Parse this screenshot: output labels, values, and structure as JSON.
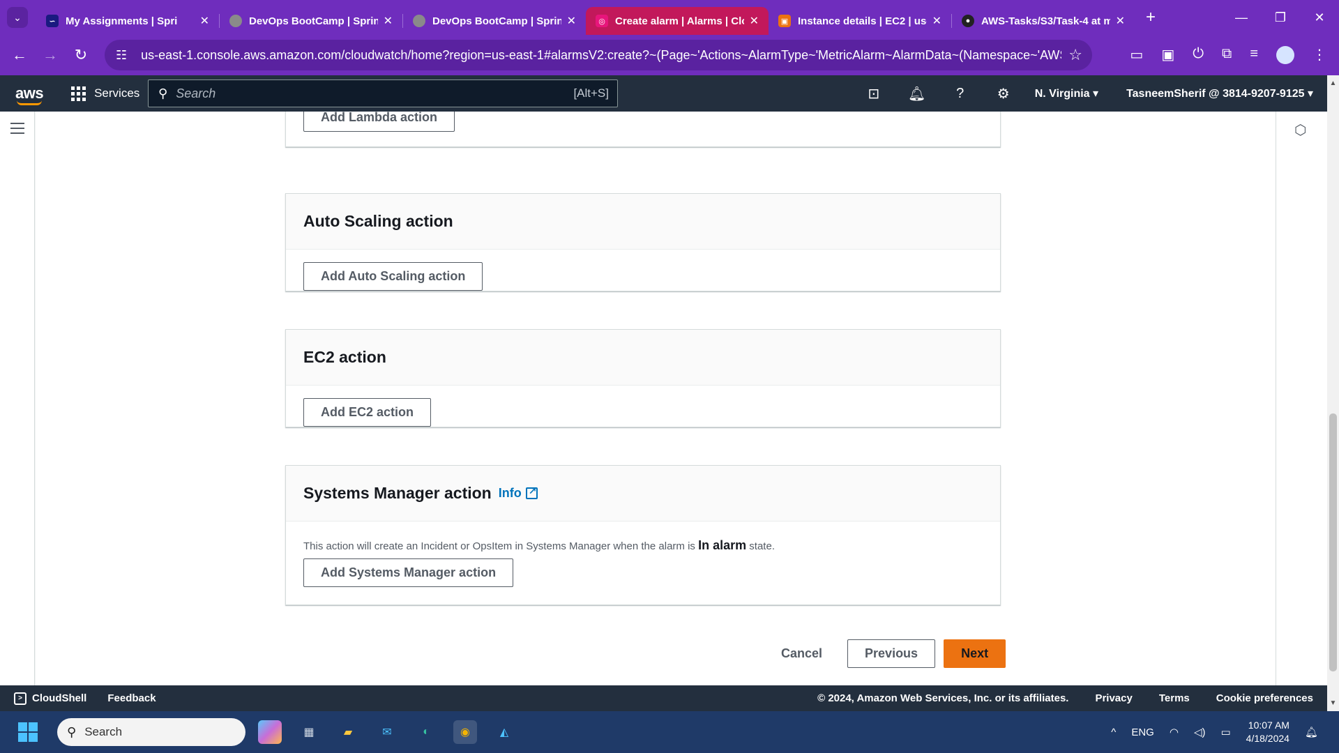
{
  "browser": {
    "tabs": [
      {
        "title": "My Assignments | Spri",
        "favicon": "sprints-icon",
        "color": "#7b3fe4",
        "active": false
      },
      {
        "title": "DevOps BootCamp | Sprin",
        "favicon": "globe-icon",
        "color": "#8a8a8a",
        "active": false
      },
      {
        "title": "DevOps BootCamp | Sprin",
        "favicon": "globe-icon",
        "color": "#8a8a8a",
        "active": false
      },
      {
        "title": "Create alarm | Alarms | Clo",
        "favicon": "cloudwatch-icon",
        "color": "#e7157b",
        "active": true
      },
      {
        "title": "Instance details | EC2 | us-",
        "favicon": "ec2-icon",
        "color": "#ec7211",
        "active": false
      },
      {
        "title": "AWS-Tasks/S3/Task-4 at m",
        "favicon": "github-icon",
        "color": "#222222",
        "active": false
      }
    ],
    "url": "us-east-1.console.aws.amazon.com/cloudwatch/home?region=us-east-1#alarmsV2:create?~(Page~'Actions~AlarmType~'MetricAlarm~AlarmData~(Namespace~'AWS*2f..."
  },
  "awsnav": {
    "logo": "aws",
    "services_label": "Services",
    "search_placeholder": "Search",
    "search_shortcut": "[Alt+S]",
    "region": "N. Virginia",
    "account": "TasneemSherif @ 3814-9207-9125"
  },
  "sections": {
    "lambda": {
      "button": "Add Lambda action"
    },
    "autoscaling": {
      "title": "Auto Scaling action",
      "button": "Add Auto Scaling action"
    },
    "ec2": {
      "title": "EC2 action",
      "button": "Add EC2 action"
    },
    "ssm": {
      "title": "Systems Manager action",
      "info": "Info",
      "desc_before": "This action will create an Incident or OpsItem in Systems Manager when the alarm is",
      "desc_bold": "In alarm",
      "desc_after": "state.",
      "button": "Add Systems Manager action"
    }
  },
  "wizard": {
    "cancel": "Cancel",
    "previous": "Previous",
    "next": "Next"
  },
  "footer": {
    "cloudshell": "CloudShell",
    "feedback": "Feedback",
    "copyright": "© 2024, Amazon Web Services, Inc. or its affiliates.",
    "privacy": "Privacy",
    "terms": "Terms",
    "cookies": "Cookie preferences"
  },
  "taskbar": {
    "search_placeholder": "Search",
    "language": "ENG",
    "time": "10:07 AM",
    "date": "4/18/2024"
  },
  "colors": {
    "accent": "#ec7211",
    "aws_nav": "#232f3e",
    "link": "#0073bb",
    "browser_frame": "#6f2dbd"
  }
}
